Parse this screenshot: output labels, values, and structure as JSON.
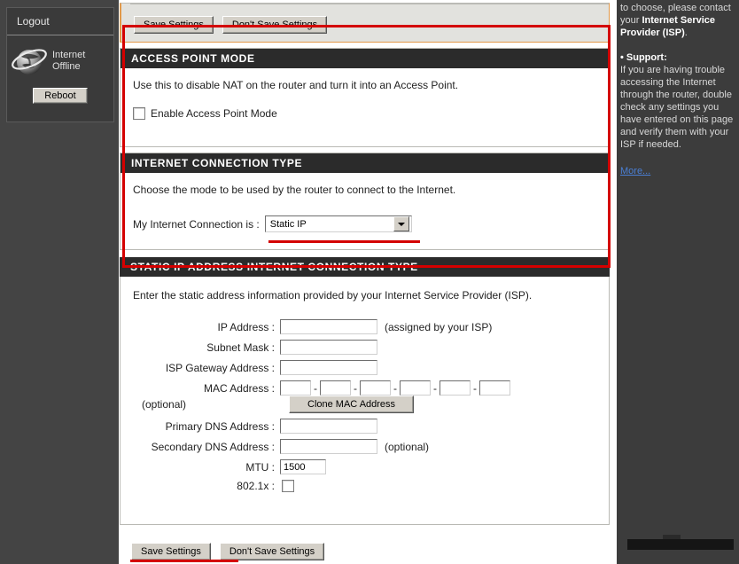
{
  "sidebar": {
    "logout_label": "Logout",
    "status_icon": "globe-icon",
    "status_line1": "Internet",
    "status_line2": "Offline",
    "reboot_label": "Reboot"
  },
  "top_actions": {
    "save_label": "Save Settings",
    "dont_save_label": "Don't Save Settings"
  },
  "access_point": {
    "heading": "ACCESS POINT MODE",
    "description": "Use this to disable NAT on the router and turn it into an Access Point.",
    "checkbox_label": "Enable Access Point Mode",
    "checkbox_checked": false
  },
  "connection_type": {
    "heading": "INTERNET CONNECTION TYPE",
    "description": "Choose the mode to be used by the router to connect to the Internet.",
    "field_label": "My Internet Connection is :",
    "selected_value": "Static IP"
  },
  "static_ip": {
    "heading": "STATIC IP ADDRESS INTERNET CONNECTION TYPE",
    "description": "Enter the static address information provided by your Internet Service Provider (ISP).",
    "ip_label": "IP Address :",
    "ip_value": "",
    "ip_hint": "(assigned by your ISP)",
    "subnet_label": "Subnet Mask :",
    "subnet_value": "",
    "gateway_label": "ISP Gateway Address :",
    "gateway_value": "",
    "mac_label": "MAC Address :",
    "mac_octets": [
      "",
      "",
      "",
      "",
      "",
      ""
    ],
    "mac_separator": "-",
    "mac_optional": "(optional)",
    "clone_mac_label": "Clone MAC Address",
    "dns1_label": "Primary DNS Address :",
    "dns1_value": "",
    "dns2_label": "Secondary DNS Address :",
    "dns2_value": "",
    "dns2_optional": "(optional)",
    "mtu_label": "MTU :",
    "mtu_value": "1500",
    "dot1x_label": "802.1x :",
    "dot1x_checked": false
  },
  "bottom_actions": {
    "save_label": "Save Settings",
    "dont_save_label": "Don't Save Settings"
  },
  "help": {
    "para1_pre": "to choose, please contact your ",
    "para1_bold": "Internet Service Provider (ISP)",
    "para1_post": ".",
    "support_bullet": "•  Support:",
    "support_text": "If you are having trouble accessing the Internet through the router, double check any settings you have entered on this page and verify them with your ISP if needed.",
    "more_label": "More..."
  },
  "annotations": {
    "highlight_color": "#d40000"
  }
}
